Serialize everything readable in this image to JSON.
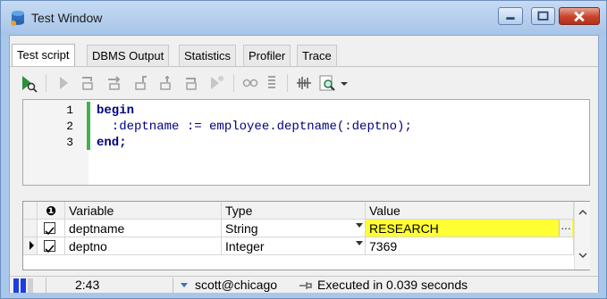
{
  "window": {
    "title": "Test Window",
    "colors": {
      "title_bar": "#a9c7ea",
      "close": "#c7432a"
    }
  },
  "tabs": [
    {
      "label": "Test script",
      "active": true
    },
    {
      "label": "DBMS Output",
      "active": false
    },
    {
      "label": "Statistics",
      "active": false
    },
    {
      "label": "Profiler",
      "active": false
    },
    {
      "label": "Trace",
      "active": false
    }
  ],
  "toolbar": {
    "icons": [
      "start-debugger-icon",
      "execute-icon",
      "step-into-icon",
      "step-over-icon",
      "step-out-icon",
      "run-to-exception-icon",
      "run-to-next-icon",
      "break-icon",
      "watch-icon",
      "stack-icon",
      "compile-icon",
      "search-icon"
    ]
  },
  "editor": {
    "lines": [
      {
        "num": "1",
        "keyword": "begin",
        "body": ""
      },
      {
        "num": "2",
        "keyword": "",
        "body": "  :deptname := employee.deptname(:deptno);"
      },
      {
        "num": "3",
        "keyword": "end;",
        "body": ""
      }
    ]
  },
  "variables": {
    "headers": {
      "use": "",
      "variable": "Variable",
      "type": "Type",
      "value": "Value"
    },
    "rows": [
      {
        "checked": true,
        "variable": "deptname",
        "type": "String",
        "value": "RESEARCH",
        "highlight": "#ffff33"
      },
      {
        "checked": true,
        "variable": "deptno",
        "type": "Integer",
        "value": "7369",
        "highlight": ""
      }
    ]
  },
  "status": {
    "cursor": "2:43",
    "connection": "scott@chicago",
    "message": "Executed in 0.039 seconds"
  }
}
